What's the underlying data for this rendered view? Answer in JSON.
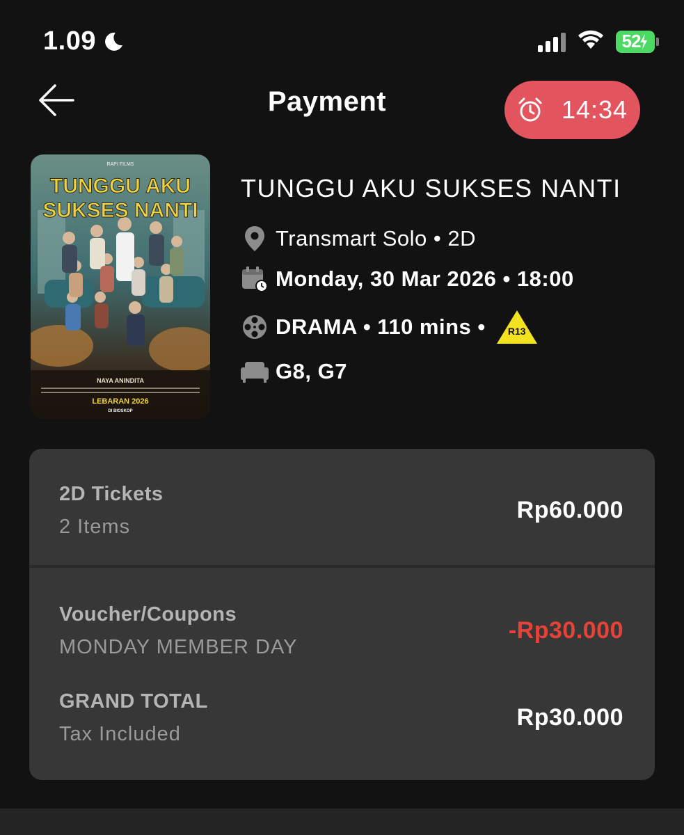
{
  "status_bar": {
    "time": "1.09",
    "moon_icon": "moon-icon",
    "battery": "52"
  },
  "header": {
    "back_icon": "arrow-left-icon",
    "title": "Payment",
    "timer": "14:34",
    "timer_icon": "alarm-clock-icon",
    "timer_color": "#e2555f"
  },
  "movie": {
    "title": "TUNGGU AKU SUKSES NANTI",
    "location": "Transmart Solo • 2D",
    "datetime": "Monday, 30 Mar 2026 • 18:00",
    "genre_duration": "DRAMA • 110 mins •",
    "rating": "R13",
    "rating_color": "#f3e21f",
    "seats": "G8, G7",
    "poster": {
      "title_line1": "TUNGGU AKU",
      "title_line2": "SUKSES NANTI",
      "studio": "RAPI FILMS",
      "director": "NAYA ANINDITA",
      "release": "LEBARAN 2026",
      "release_sub": "DI BIOSKOP"
    }
  },
  "summary": {
    "tickets_label": "2D Tickets",
    "tickets_count": "2 Items",
    "tickets_amount": "Rp60.000",
    "voucher_label": "Voucher/Coupons",
    "voucher_name": "MONDAY MEMBER DAY",
    "voucher_amount": "-Rp30.000",
    "voucher_color": "#e5433a",
    "total_label": "GRAND TOTAL",
    "total_sub": "Tax Included",
    "total_amount": "Rp30.000"
  }
}
